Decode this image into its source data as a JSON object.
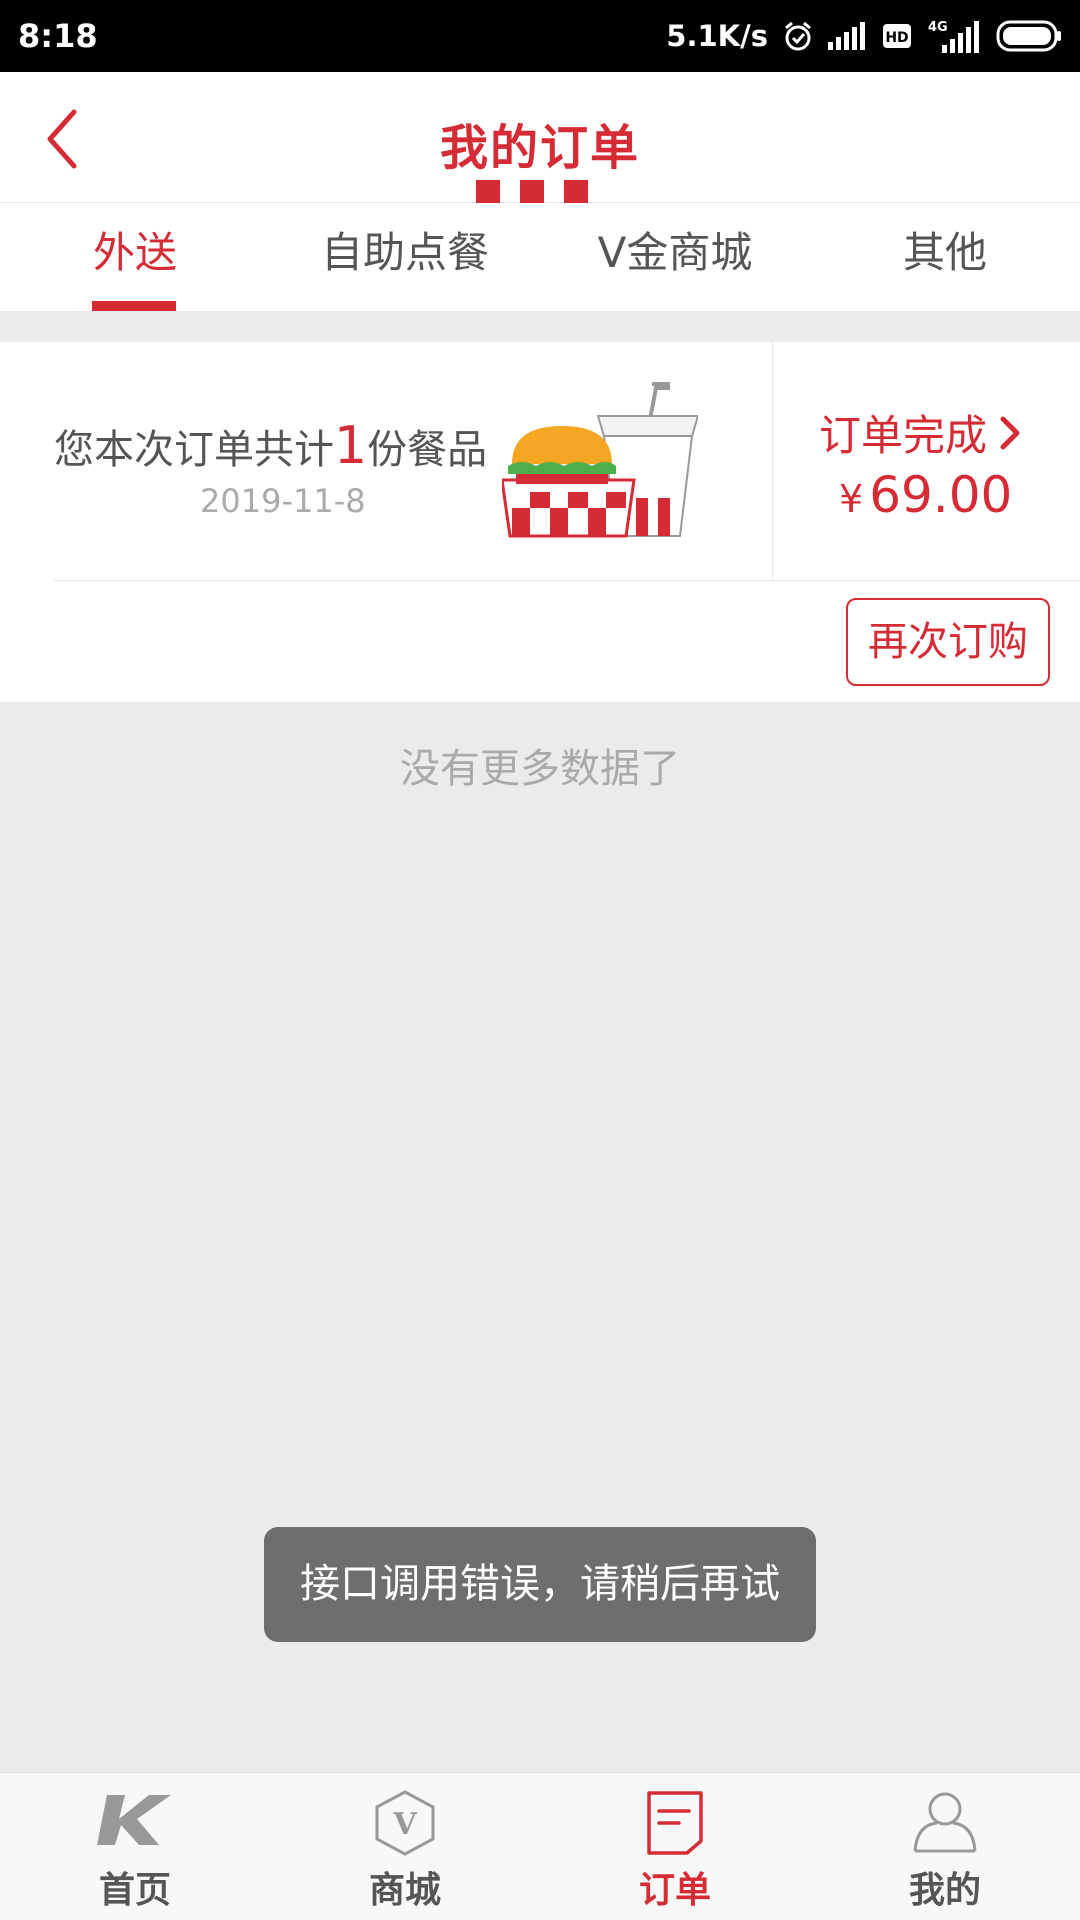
{
  "status_bar": {
    "time": "8:18",
    "net_speed": "5.1K/s",
    "network_type": "4G",
    "hd_badge": "HD"
  },
  "header": {
    "title": "我的订单",
    "accent_color": "#d42b34"
  },
  "tabs": [
    {
      "label": "外送",
      "active": true
    },
    {
      "label": "自助点餐",
      "active": false
    },
    {
      "label": "V金商城",
      "active": false
    },
    {
      "label": "其他",
      "active": false
    }
  ],
  "order": {
    "summary_prefix": "您本次订单共计",
    "item_count": "1",
    "summary_suffix": "份餐品",
    "date": "2019-11-8",
    "status": "订单完成",
    "currency": "¥",
    "amount": "69.00",
    "reorder_label": "再次订购"
  },
  "list_footer": "没有更多数据了",
  "toast": "接口调用错误，请稍后再试",
  "bottom_nav": [
    {
      "label": "首页",
      "icon": "home-k-icon",
      "active": false
    },
    {
      "label": "商城",
      "icon": "mall-v-icon",
      "active": false
    },
    {
      "label": "订单",
      "icon": "order-doc-icon",
      "active": true
    },
    {
      "label": "我的",
      "icon": "user-icon",
      "active": false
    }
  ]
}
